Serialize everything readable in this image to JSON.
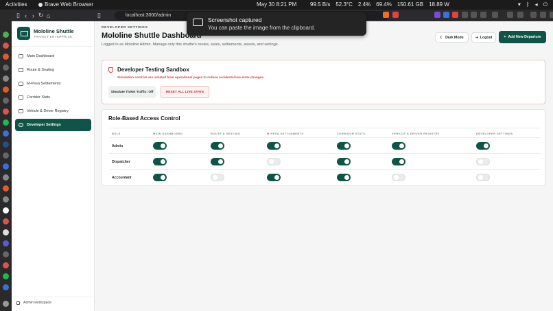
{
  "os": {
    "activities": "Activities",
    "app_name": "Brave Web Browser",
    "clock": "May 30  8:21 PM",
    "net": "99.5 B/s",
    "temp": "52.3°C",
    "cpu": "2.4%",
    "mem": "69.4%",
    "disk": "150.61 GB",
    "power": "18.89 W"
  },
  "browser": {
    "url": "localhost:3000/admin"
  },
  "toast": {
    "title": "Screenshot captured",
    "message": "You can paste the image from the clipboard."
  },
  "sidebar": {
    "brand_name": "Mololine Shuttle",
    "brand_sub": "TRANSIT ENTERPRISE",
    "items": [
      {
        "label": "Main Dashboard"
      },
      {
        "label": "Route & Seating"
      },
      {
        "label": "M-Pesa Settlements"
      },
      {
        "label": "Corridor Stats"
      },
      {
        "label": "Vehicle & Driver Registry"
      },
      {
        "label": "Developer Settings"
      }
    ],
    "footer": "Admin workspace"
  },
  "header": {
    "eyebrow": "DEVELOPER SETTINGS",
    "title": "Mololine Shuttle Dashboard",
    "subtitle": "Logged in as Mololine Admin. Manage only this shuttle's routes, seats, settlements, assets, and settings.",
    "dark_mode": "Dark Mode",
    "logout": "Logout",
    "add_departure": "Add New Departure"
  },
  "sandbox": {
    "title": "Developer Testing Sandbox",
    "description": "Simulation controls are isolated from operational pages to reduce accidental live-state changes.",
    "simulate_label": "Simulate Ticket Traffic: Off",
    "reset_label": "RESET ALL LIVE STATE"
  },
  "rbac": {
    "title": "Role-Based Access Control",
    "columns": [
      "ROLE",
      "MAIN DASHBOARD",
      "ROUTE & SEATING",
      "M-PESA SETTLEMENTS",
      "CORRIDOR STATS",
      "VEHICLE & DRIVER REGISTRY",
      "DEVELOPER SETTINGS"
    ],
    "rows": [
      {
        "role": "Admin",
        "access": [
          true,
          true,
          true,
          true,
          true,
          true
        ]
      },
      {
        "role": "Dispatcher",
        "access": [
          true,
          true,
          false,
          true,
          true,
          false
        ]
      },
      {
        "role": "Accountant",
        "access": [
          true,
          false,
          true,
          true,
          false,
          false
        ]
      }
    ]
  },
  "colors": {
    "accent": "#0e5547",
    "danger": "#d23b3b"
  }
}
